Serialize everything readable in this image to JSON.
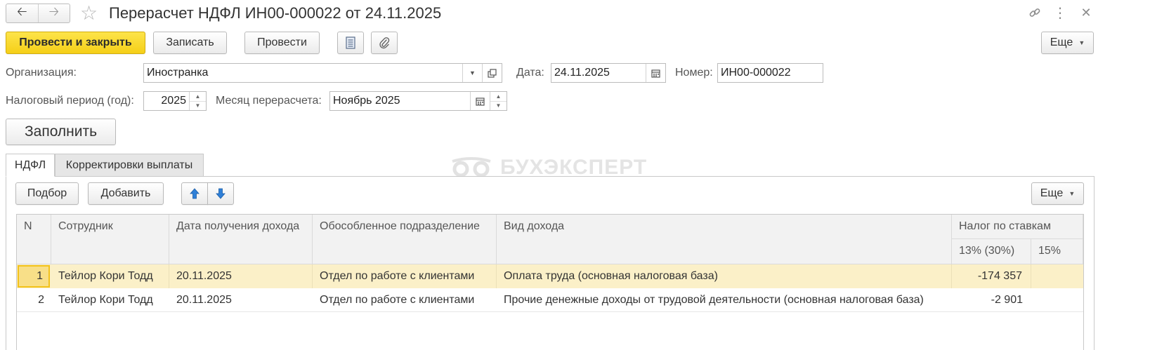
{
  "window": {
    "title": "Перерасчет НДФЛ ИН00-000022 от 24.11.2025"
  },
  "toolbar": {
    "post_close_label": "Провести и закрыть",
    "save_label": "Записать",
    "post_label": "Провести",
    "more_label": "Еще"
  },
  "form": {
    "org_label": "Организация:",
    "org_value": "Иностранка",
    "date_label": "Дата:",
    "date_value": "24.11.2025",
    "number_label": "Номер:",
    "number_value": "ИН00-000022",
    "period_label": "Налоговый период (год):",
    "period_value": "2025",
    "month_label": "Месяц перерасчета:",
    "month_value": "Ноябрь 2025",
    "fill_label": "Заполнить"
  },
  "tabs": [
    {
      "label": "НДФЛ",
      "active": true
    },
    {
      "label": "Корректировки выплаты",
      "active": false
    }
  ],
  "watermark": "БУХЭКСПЕРТ",
  "table_toolbar": {
    "pick_label": "Подбор",
    "add_label": "Добавить",
    "more_label": "Еще"
  },
  "table": {
    "columns": {
      "n": "N",
      "employee": "Сотрудник",
      "income_date": "Дата получения дохода",
      "division": "Обособленное подразделение",
      "income_type": "Вид дохода",
      "tax_group": "Налог по ставкам",
      "rate13": "13% (30%)",
      "rate15": "15%"
    },
    "rows": [
      {
        "n": "1",
        "employee": "Тейлор Кори Тодд",
        "income_date": "20.11.2025",
        "division": "Отдел по работе с клиентами",
        "income_type": "Оплата труда (основная налоговая база)",
        "rate13": "-174 357",
        "rate15": ""
      },
      {
        "n": "2",
        "employee": "Тейлор Кори Тодд",
        "income_date": "20.11.2025",
        "division": "Отдел по работе с клиентами",
        "income_type": "Прочие денежные доходы от трудовой деятельности (основная налоговая база)",
        "rate13": "-2 901",
        "rate15": ""
      }
    ]
  },
  "colors": {
    "primary_button": "#f5cf18",
    "selected_row": "#fbf0c8",
    "arrow_blue": "#2f80d8"
  }
}
